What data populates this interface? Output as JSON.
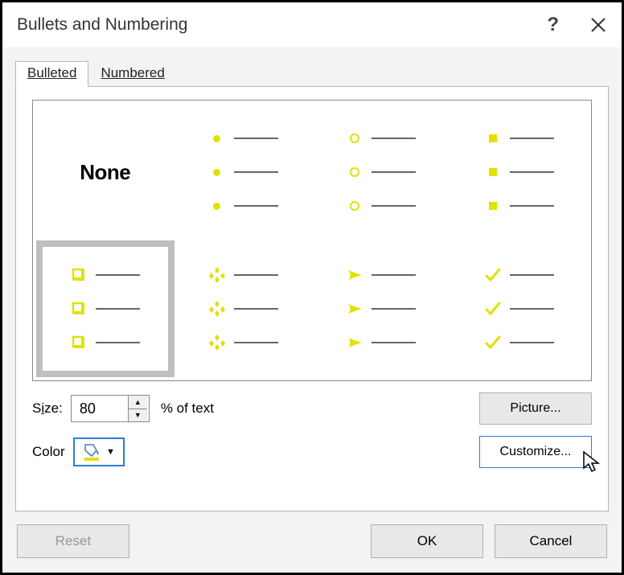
{
  "dialog": {
    "title": "Bullets and Numbering",
    "help": "?"
  },
  "tabs": {
    "bulleted": "Bulleted",
    "numbered": "Numbered"
  },
  "grid": {
    "none": "None"
  },
  "size": {
    "label_pre": "S",
    "label_u": "i",
    "label_post": "ze:",
    "value": "80",
    "suffix": "% of text"
  },
  "color": {
    "label": "Color"
  },
  "buttons": {
    "picture_u": "P",
    "picture_rest": "icture...",
    "customize_pre": "C",
    "customize_u": "u",
    "customize_rest": "stomize...",
    "reset": "Reset",
    "ok": "OK",
    "cancel": "Cancel"
  },
  "bullet_color": "#e1e100"
}
